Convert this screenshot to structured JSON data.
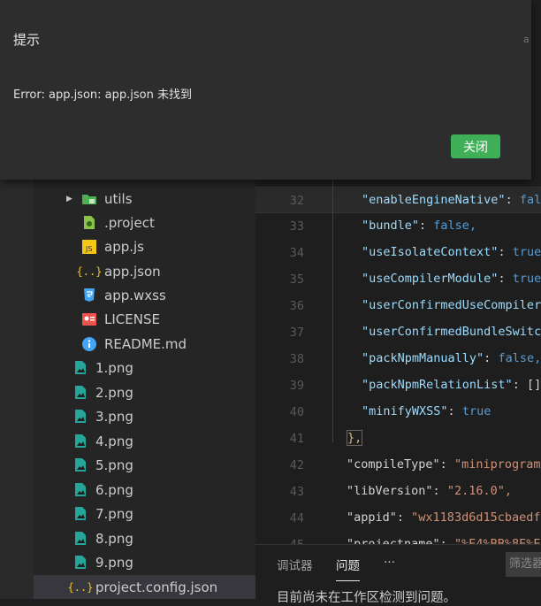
{
  "dialog": {
    "title": "提示",
    "message": "Error: app.json: app.json 未找到",
    "close_label": "关闭",
    "edge_text": "a"
  },
  "explorer": {
    "items": [
      {
        "label": "utils",
        "icon": "folder-icon",
        "expandable": true
      },
      {
        "label": ".project",
        "icon": "project-file-icon"
      },
      {
        "label": "app.js",
        "icon": "js-file-icon"
      },
      {
        "label": "app.json",
        "icon": "json-file-icon"
      },
      {
        "label": "app.wxss",
        "icon": "css-file-icon"
      },
      {
        "label": "LICENSE",
        "icon": "license-file-icon"
      },
      {
        "label": "README.md",
        "icon": "info-file-icon"
      },
      {
        "label": "1.png",
        "icon": "image-file-icon"
      },
      {
        "label": "2.png",
        "icon": "image-file-icon"
      },
      {
        "label": "3.png",
        "icon": "image-file-icon"
      },
      {
        "label": "4.png",
        "icon": "image-file-icon"
      },
      {
        "label": "5.png",
        "icon": "image-file-icon"
      },
      {
        "label": "6.png",
        "icon": "image-file-icon"
      },
      {
        "label": "7.png",
        "icon": "image-file-icon"
      },
      {
        "label": "8.png",
        "icon": "image-file-icon"
      },
      {
        "label": "9.png",
        "icon": "image-file-icon"
      },
      {
        "label": "project.config.json",
        "icon": "json-file-icon",
        "selected": true
      }
    ]
  },
  "editor": {
    "lines": [
      {
        "n": "32",
        "key": "\"enableEngineNative\"",
        "rest": "fal",
        "type": "bool"
      },
      {
        "n": "33",
        "key": "\"bundle\"",
        "rest": "false,",
        "type": "bool"
      },
      {
        "n": "34",
        "key": "\"useIsolateContext\"",
        "rest": "true",
        "type": "bool"
      },
      {
        "n": "35",
        "key": "\"useCompilerModule\"",
        "rest": "true",
        "type": "bool"
      },
      {
        "n": "36",
        "key": "\"userConfirmedUseCompiler",
        "rest": "",
        "type": "bool"
      },
      {
        "n": "37",
        "key": "\"userConfirmedBundleSwitc",
        "rest": "",
        "type": "bool"
      },
      {
        "n": "38",
        "key": "\"packNpmManually\"",
        "rest": "false,",
        "type": "bool"
      },
      {
        "n": "39",
        "key": "\"packNpmRelationList\"",
        "rest": "[]",
        "type": "bool"
      },
      {
        "n": "40",
        "key": "\"minifyWXSS\"",
        "rest": "true",
        "type": "bool"
      },
      {
        "n": "41",
        "key": "},",
        "rest": "",
        "type": "brace"
      },
      {
        "n": "42",
        "key": "\"compileType\"",
        "rest": "\"miniprogram",
        "type": "str"
      },
      {
        "n": "43",
        "key": "\"libVersion\"",
        "rest": "\"2.16.0\",",
        "type": "str"
      },
      {
        "n": "44",
        "key": "\"appid\"",
        "rest": "\"wx1183d6d15cbaedf",
        "type": "str"
      },
      {
        "n": "45",
        "key": "\"projectname\"",
        "rest": "\"%E4%BB%8E%E9",
        "type": "str"
      }
    ]
  },
  "panel": {
    "tabs": [
      "调试器",
      "问题"
    ],
    "more": "···",
    "filter_placeholder": "筛选器",
    "message": "目前尚未在工作区检测到问题。"
  }
}
